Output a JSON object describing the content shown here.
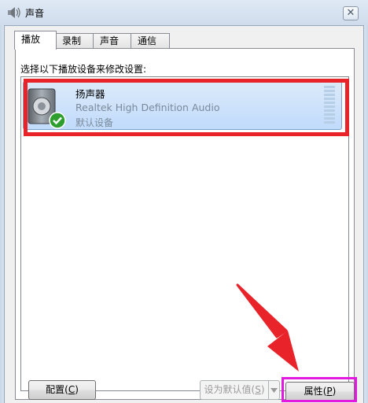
{
  "window": {
    "title": "声音",
    "close_glyph": "✕"
  },
  "tabs": [
    {
      "label": "播放",
      "active": true
    },
    {
      "label": "录制",
      "active": false
    },
    {
      "label": "声音",
      "active": false
    },
    {
      "label": "通信",
      "active": false
    }
  ],
  "playback": {
    "instruction": "选择以下播放设备来修改设置:",
    "devices": [
      {
        "name": "扬声器",
        "description": "Realtek High Definition Audio",
        "status": "默认设备",
        "icon": "speaker-icon",
        "status_icon": "default-check-icon",
        "selected": true
      }
    ]
  },
  "buttons": {
    "configure": {
      "label": "配置",
      "accel": "C"
    },
    "set_default": {
      "label": "设为默认值",
      "accel": "S",
      "enabled": false
    },
    "properties": {
      "label": "属性",
      "accel": "P"
    }
  },
  "annotations": {
    "highlight_color": "#e8232a",
    "button_highlight_color": "#e21adf",
    "arrow_color": "#e8232a"
  }
}
